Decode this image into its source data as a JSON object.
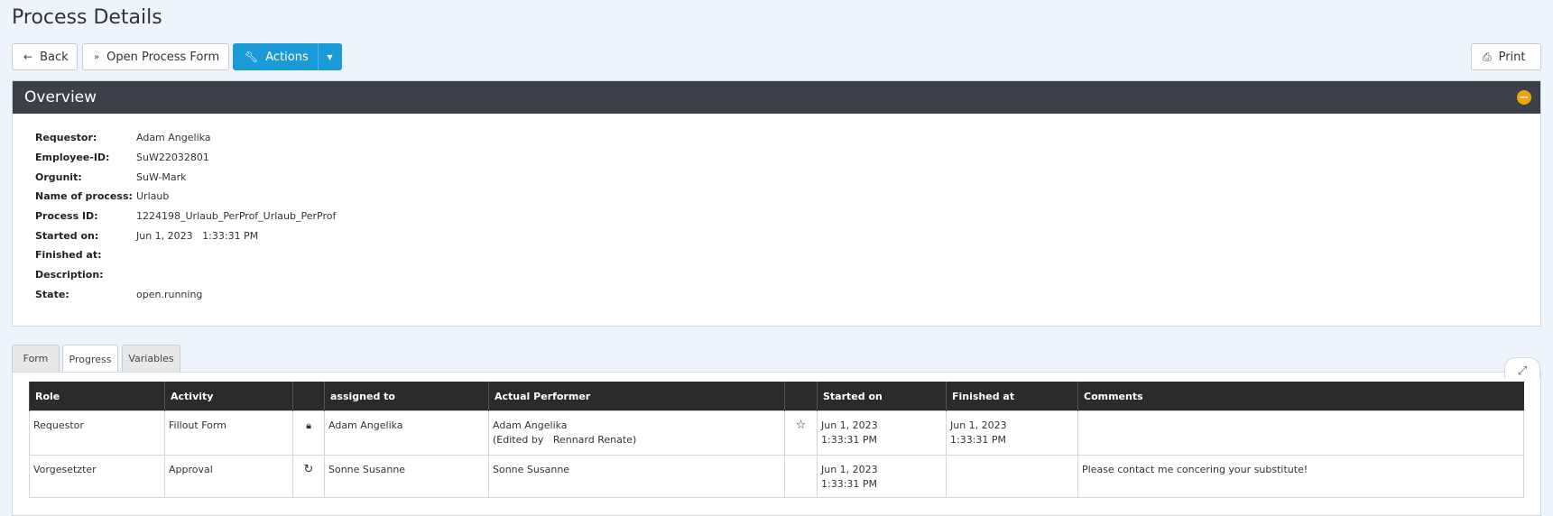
{
  "page": {
    "title": "Process Details"
  },
  "toolbar": {
    "back_label": "Back",
    "open_form_label": "Open Process Form",
    "actions_label": "Actions",
    "print_label": "Print"
  },
  "overview": {
    "title": "Overview",
    "fields": [
      {
        "label": "Requestor:",
        "value": "Adam Angelika"
      },
      {
        "label": "Employee-ID:",
        "value": "SuW22032801"
      },
      {
        "label": "Orgunit:",
        "value": "SuW-Mark"
      },
      {
        "label": "Name of process:",
        "value": "Urlaub"
      },
      {
        "label": "Process ID:",
        "value": "1224198_Urlaub_PerProf_Urlaub_PerProf"
      },
      {
        "label": "Started on:",
        "value": "Jun 1, 2023   1:33:31 PM"
      },
      {
        "label": "Finished at:",
        "value": ""
      },
      {
        "label": "Description:",
        "value": ""
      },
      {
        "label": "State:",
        "value": "open.running"
      }
    ]
  },
  "tabs": [
    {
      "label": "Form"
    },
    {
      "label": "Progress"
    },
    {
      "label": "Variables"
    }
  ],
  "progress_table": {
    "headers": [
      "Role",
      "Activity",
      "",
      "assigned to",
      "Actual Performer",
      "",
      "Started on",
      "Finished at",
      "Comments"
    ],
    "rows": [
      {
        "role": "Requestor",
        "activity": "Fillout Form",
        "status_icon": "lock-icon",
        "assigned_to": "Adam Angelika",
        "performer": "Adam Angelika",
        "performer_note": "(Edited by   Rennard Renate)",
        "flag_icon": "star-outline-icon",
        "started_date": "Jun 1, 2023",
        "started_time": "1:33:31 PM",
        "finished_date": "Jun 1, 2023",
        "finished_time": "1:33:31 PM",
        "comments": ""
      },
      {
        "role": "Vorgesetzter",
        "activity": "Approval",
        "status_icon": "refresh-icon",
        "assigned_to": "Sonne Susanne",
        "performer": "Sonne Susanne",
        "performer_note": "",
        "flag_icon": "",
        "started_date": "Jun 1, 2023",
        "started_time": "1:33:31 PM",
        "finished_date": "",
        "finished_time": "",
        "comments": "Please contact me concering your substitute!"
      }
    ]
  },
  "colors": {
    "primary": "#1a9bd7",
    "panel_header": "#3c4149",
    "table_header": "#2b2b2b",
    "collapse_accent": "#f0a30a"
  }
}
